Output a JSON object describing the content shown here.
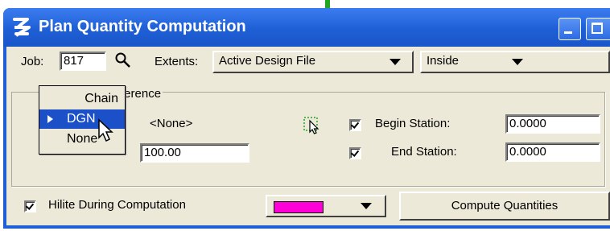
{
  "window": {
    "title": "Plan Quantity Computation"
  },
  "job": {
    "label": "Job:",
    "value": "817"
  },
  "extents": {
    "label": "Extents:",
    "scope_value": "Active Design File",
    "mode_value": "Inside"
  },
  "group": {
    "label_partial": "ference"
  },
  "popup": {
    "items": [
      "Chain",
      "DGN",
      "None"
    ],
    "selected_index": 1
  },
  "reference": {
    "value": "<None>",
    "offset_value": "100.00"
  },
  "begin_station": {
    "label": "Begin Station:",
    "value": "0.0000",
    "checked": true
  },
  "end_station": {
    "label": "End Station:",
    "value": "0.0000",
    "checked": true
  },
  "hilite": {
    "label": "Hilite During Computation",
    "checked": true,
    "color": "#ff00d8"
  },
  "compute_button": {
    "label": "Compute Quantities"
  },
  "colors": {
    "titlebar": "#1f5fd6",
    "dialog_bg": "#ece9d8",
    "selection": "#1c50c8"
  }
}
